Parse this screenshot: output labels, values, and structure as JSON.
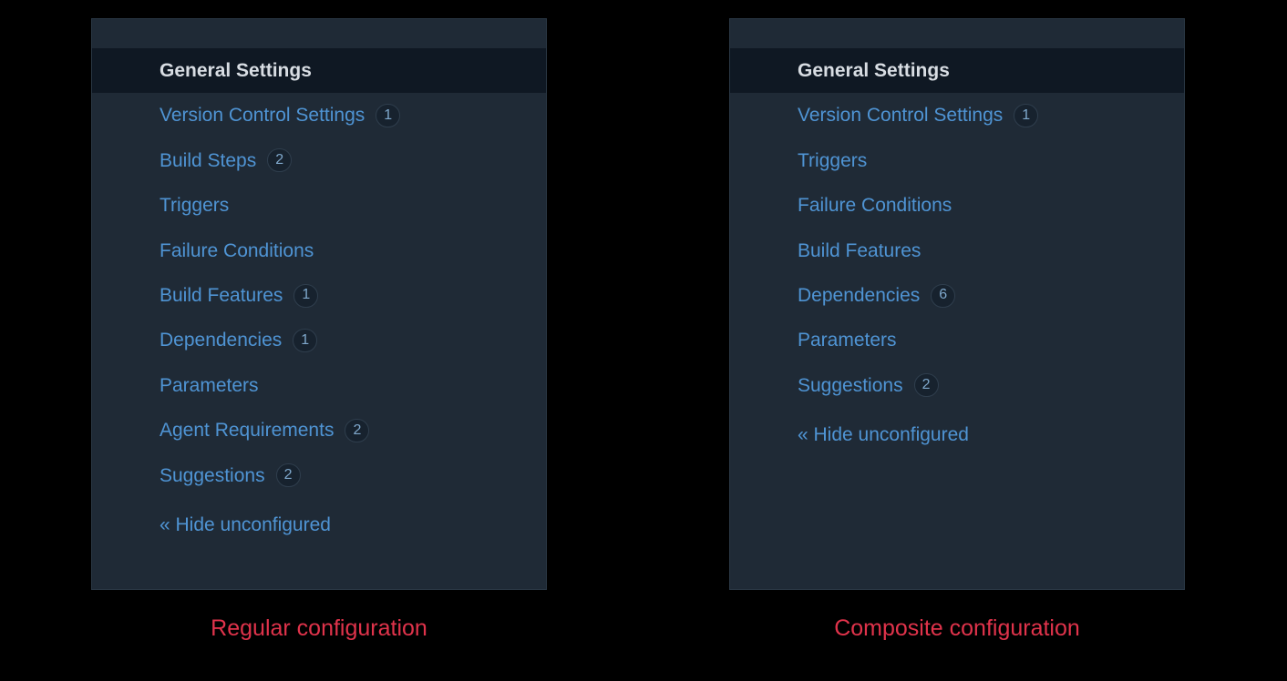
{
  "left": {
    "caption": "Regular configuration",
    "items": [
      {
        "label": "General Settings",
        "selected": true
      },
      {
        "label": "Version Control Settings",
        "count": "1"
      },
      {
        "label": "Build Steps",
        "count": "2"
      },
      {
        "label": "Triggers"
      },
      {
        "label": "Failure Conditions"
      },
      {
        "label": "Build Features",
        "count": "1"
      },
      {
        "label": "Dependencies",
        "count": "1"
      },
      {
        "label": "Parameters"
      },
      {
        "label": "Agent Requirements",
        "count": "2"
      },
      {
        "label": "Suggestions",
        "count": "2"
      }
    ],
    "hide_label": "« Hide unconfigured"
  },
  "right": {
    "caption": "Composite configuration",
    "items": [
      {
        "label": "General Settings",
        "selected": true
      },
      {
        "label": "Version Control Settings",
        "count": "1"
      },
      {
        "label": "Triggers"
      },
      {
        "label": "Failure Conditions"
      },
      {
        "label": "Build Features"
      },
      {
        "label": "Dependencies",
        "count": "6"
      },
      {
        "label": "Parameters"
      },
      {
        "label": "Suggestions",
        "count": "2"
      }
    ],
    "hide_label": "« Hide unconfigured"
  }
}
